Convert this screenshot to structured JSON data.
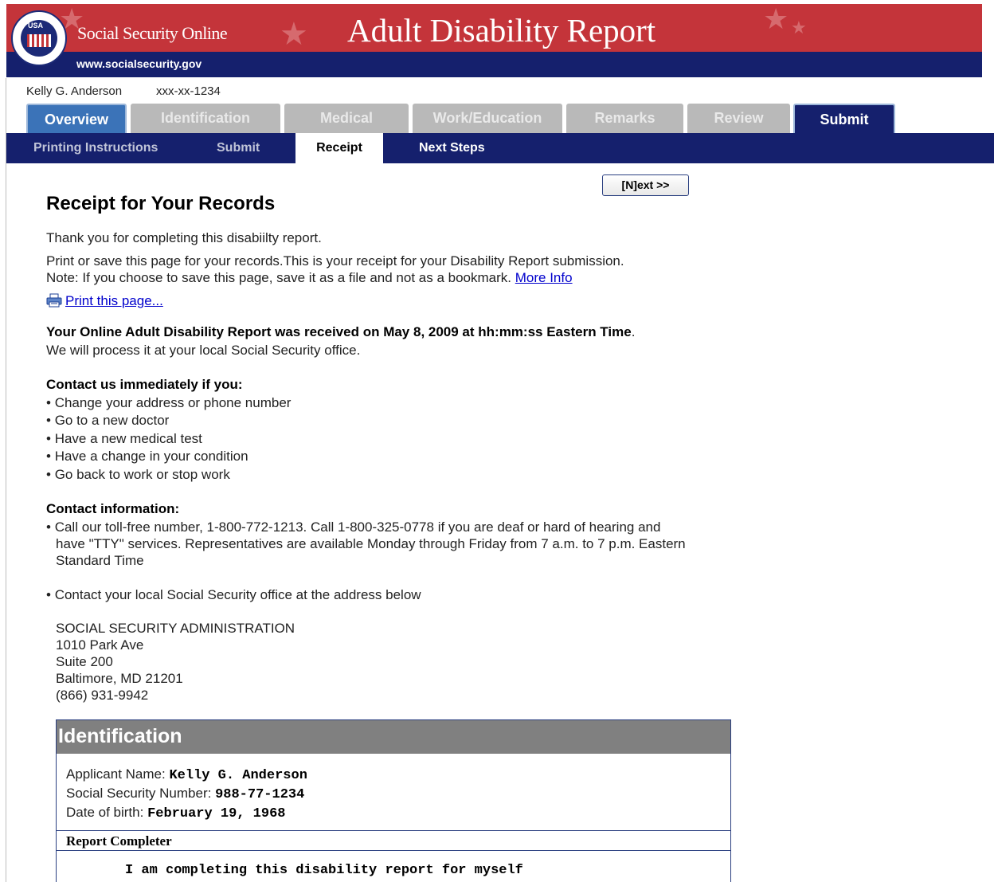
{
  "banner": {
    "site_name": "Social Security Online",
    "site_url": "www.socialsecurity.gov",
    "title": "Adult Disability Report",
    "seal_text": "USA",
    "colors": {
      "red": "#c4343a",
      "navy": "#15206d"
    }
  },
  "user": {
    "name": "Kelly G. Anderson",
    "ssn_masked": "xxx-xx-1234"
  },
  "tabs": [
    {
      "label": "Overview",
      "state": "enabled"
    },
    {
      "label": "Identification",
      "state": "disabled"
    },
    {
      "label": "Medical",
      "state": "disabled"
    },
    {
      "label": "Work/Education",
      "state": "disabled"
    },
    {
      "label": "Remarks",
      "state": "disabled"
    },
    {
      "label": "Review",
      "state": "disabled"
    },
    {
      "label": "Submit",
      "state": "active"
    }
  ],
  "subtabs": [
    {
      "label": "Printing Instructions"
    },
    {
      "label": "Submit"
    },
    {
      "label": "Receipt",
      "current": true
    },
    {
      "label": "Next Steps"
    }
  ],
  "next_button": "[N]ext >>",
  "content": {
    "heading": "Receipt for Your Records",
    "thank_you": "Thank you for completing this disabiilty report.",
    "print_save": "Print or save this page for your records.This is your receipt for your Disability Report submission.",
    "note": "Note: If you choose to save this page, save it as a file and not as a bookmark.",
    "more_info": "More Info",
    "print_link": "Print this page...",
    "received": "Your Online Adult Disability Report was received on May 8, 2009 at hh:mm:ss Eastern Time",
    "received_end": ".",
    "process": "We will process it at your local Social Security office.",
    "contact_heading": "Contact us immediately if you:",
    "contact_items": [
      "Change your address or phone number",
      "Go to a new doctor",
      "Have a new medical test",
      "Have a change in your condition",
      "Go back to work or stop work"
    ],
    "info_heading": "Contact information:",
    "info_call_lines": [
      "Call our toll-free number, 1-800-772-1213. Call 1-800-325-0778 if you are deaf or hard of hearing and",
      "have \"TTY\" services. Representatives are available Monday through Friday from 7 a.m. to 7 p.m. Eastern",
      "Standard Time"
    ],
    "info_office": "Contact your local Social Security office at the address below",
    "address": [
      "SOCIAL SECURITY ADMINISTRATION",
      "1010 Park Ave",
      "Suite 200",
      "Baltimore, MD 21201",
      "(866) 931-9942"
    ]
  },
  "identification": {
    "title": "Identification",
    "applicant_label": "Applicant Name:",
    "applicant_value": "Kelly G. Anderson",
    "ssn_label": "Social Security Number:",
    "ssn_value": "988-77-1234",
    "dob_label": "Date of birth:",
    "dob_value": "February 19, 1968",
    "completer_label": "Report Completer",
    "completer_value": "I am completing this disability report for myself"
  }
}
